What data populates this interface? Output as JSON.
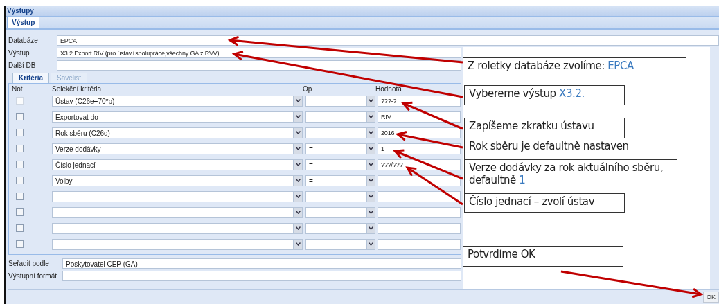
{
  "window": {
    "title": "Výstupy"
  },
  "tabs": [
    {
      "label": "Výstup",
      "selected": true
    }
  ],
  "form": [
    {
      "label": "Databáze",
      "value": "EPCA"
    },
    {
      "label": "Výstup",
      "value": "X3.2 Export RIV (pro ústav+spolupráce,všechny GA z RVV)"
    },
    {
      "label": "Další DB"
    }
  ],
  "subtabs": [
    {
      "label": "Kritéria",
      "selected": true
    },
    {
      "label": "Savelist",
      "selected": false
    }
  ],
  "criteria": {
    "columns": [
      "Not",
      "Selekční kritéria",
      "Op",
      "Hodnota"
    ],
    "rows": [
      {
        "checked": false,
        "disabled": true,
        "criterion": "Ústav (C26e+70*p)",
        "op": "=",
        "value": "???-?"
      },
      {
        "checked": false,
        "disabled": false,
        "criterion": "Exportovat do",
        "op": "=",
        "value": "RIV"
      },
      {
        "checked": false,
        "disabled": false,
        "criterion": "Rok sběru (C26d)",
        "op": "=",
        "value": "2016"
      },
      {
        "checked": false,
        "disabled": false,
        "criterion": "Verze dodávky",
        "op": "=",
        "value": "1"
      },
      {
        "checked": false,
        "disabled": false,
        "criterion": "Číslo jednací",
        "op": "=",
        "value": "???/???"
      },
      {
        "checked": false,
        "disabled": false,
        "criterion": "Volby",
        "op": "="
      },
      {
        "checked": false,
        "disabled": false
      },
      {
        "checked": false,
        "disabled": false
      },
      {
        "checked": false,
        "disabled": false
      },
      {
        "checked": false,
        "disabled": false
      }
    ]
  },
  "sort": {
    "label": "Seřadit podle",
    "value": "Poskytovatel CEP (GA)"
  },
  "output_format": {
    "label": "Výstupní formát"
  },
  "buttons": [
    "OK"
  ],
  "annotations": [
    {
      "text": "Z roletky databáze zvolíme:",
      "highlight": "EPCA"
    },
    {
      "text": "Vybereme výstup",
      "highlight": "X3.2."
    },
    {
      "text": "Zapíšeme zkratku ústavu"
    },
    {
      "text": "Rok sběru je defaultně nastaven"
    },
    {
      "text": "Verze dodávky za rok aktuálního sběru, defaultně",
      "highlight": "1"
    },
    {
      "text": "Číslo jednací – zvolí ústav"
    },
    {
      "text": "Potvrdíme OK"
    }
  ]
}
